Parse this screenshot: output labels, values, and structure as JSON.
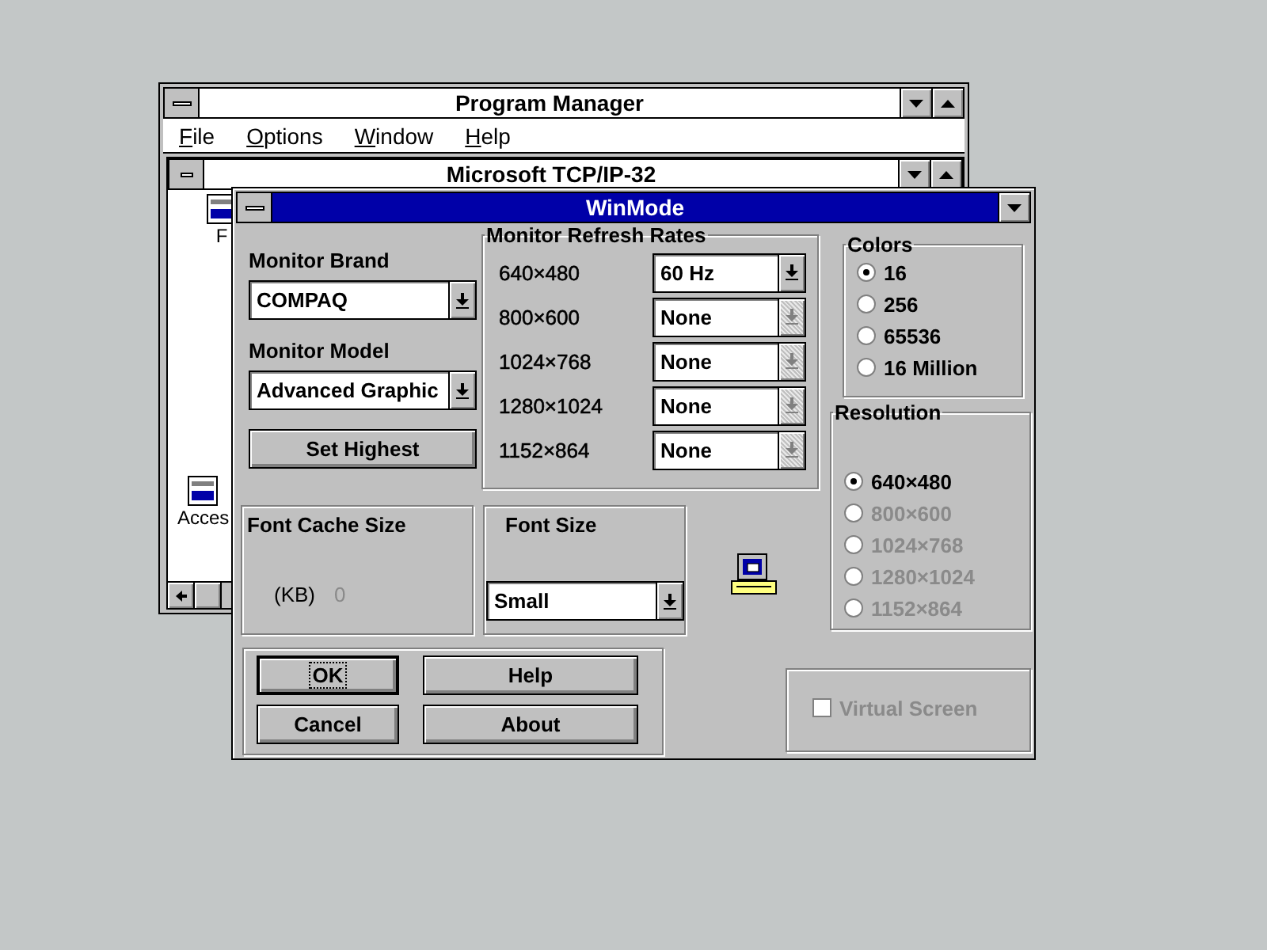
{
  "program_manager": {
    "title": "Program Manager",
    "menu": [
      {
        "label": "File"
      },
      {
        "label": "Options"
      },
      {
        "label": "Window"
      },
      {
        "label": "Help"
      }
    ]
  },
  "group_window": {
    "title": "Microsoft TCP/IP-32",
    "items": [
      {
        "label": "F"
      },
      {
        "label": "Acces"
      }
    ]
  },
  "dialog": {
    "title": "WinMode",
    "monitor_brand": {
      "label": "Monitor Brand",
      "value": "COMPAQ"
    },
    "monitor_model": {
      "label": "Monitor Model",
      "value": "Advanced Graphic"
    },
    "set_highest": "Set Highest",
    "refresh": {
      "title": "Monitor Refresh Rates",
      "rows": [
        {
          "resolution": "640×480",
          "value": "60 Hz",
          "disabled": false
        },
        {
          "resolution": "800×600",
          "value": "None",
          "disabled": true
        },
        {
          "resolution": "1024×768",
          "value": "None",
          "disabled": true
        },
        {
          "resolution": "1280×1024",
          "value": "None",
          "disabled": true
        },
        {
          "resolution": "1152×864",
          "value": "None",
          "disabled": true
        }
      ]
    },
    "colors": {
      "title": "Colors",
      "options": [
        {
          "label": "16",
          "selected": true
        },
        {
          "label": "256",
          "selected": false
        },
        {
          "label": "65536",
          "selected": false
        },
        {
          "label": "16 Million",
          "selected": false
        }
      ]
    },
    "resolution": {
      "title": "Resolution",
      "options": [
        {
          "label": "640×480",
          "selected": true,
          "disabled": false
        },
        {
          "label": "800×600",
          "selected": false,
          "disabled": true
        },
        {
          "label": "1024×768",
          "selected": false,
          "disabled": true
        },
        {
          "label": "1280×1024",
          "selected": false,
          "disabled": true
        },
        {
          "label": "1152×864",
          "selected": false,
          "disabled": true
        }
      ]
    },
    "font_cache": {
      "title": "Font Cache Size",
      "unit": "(KB)",
      "value": "0"
    },
    "font_size": {
      "title": "Font Size",
      "value": "Small"
    },
    "buttons": [
      {
        "label": "OK",
        "default": true
      },
      {
        "label": "Help",
        "default": false
      },
      {
        "label": "Cancel",
        "default": false
      },
      {
        "label": "About",
        "default": false
      }
    ],
    "virtual_screen": {
      "label": "Virtual Screen",
      "checked": false,
      "disabled": true
    }
  }
}
